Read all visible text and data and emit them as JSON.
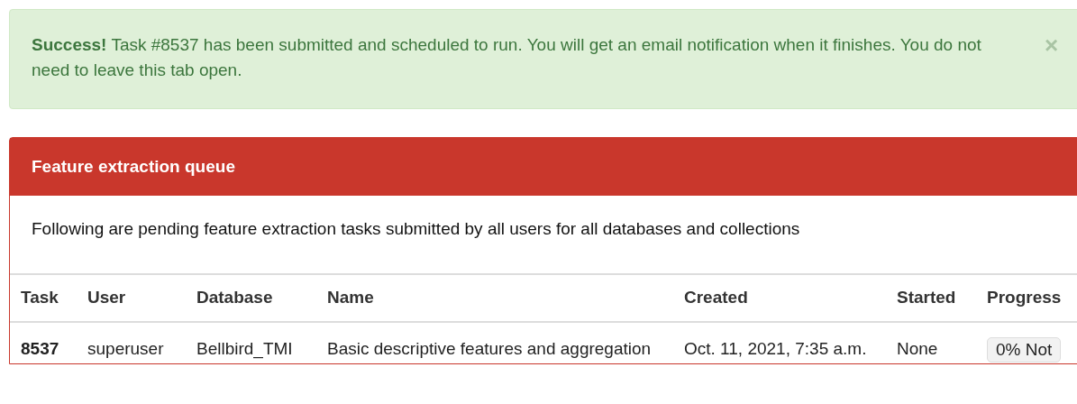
{
  "alert": {
    "strong": "Success!",
    "message": "Task #8537 has been submitted and scheduled to run. You will get an email notification when it finishes. You do not need to leave this tab open.",
    "close": "×"
  },
  "panel": {
    "title": "Feature extraction queue",
    "description": "Following are pending feature extraction tasks submitted by all users for all databases and collections",
    "table": {
      "columns": [
        "Task",
        "User",
        "Database",
        "Name",
        "Created",
        "Started",
        "Progress"
      ],
      "rows": [
        {
          "task": "8537",
          "user": "superuser",
          "database": "Bellbird_TMI",
          "name": "Basic descriptive features and aggregation",
          "created": "Oct. 11, 2021, 7:35 a.m.",
          "started": "None",
          "progress": "0% Not"
        }
      ]
    }
  }
}
